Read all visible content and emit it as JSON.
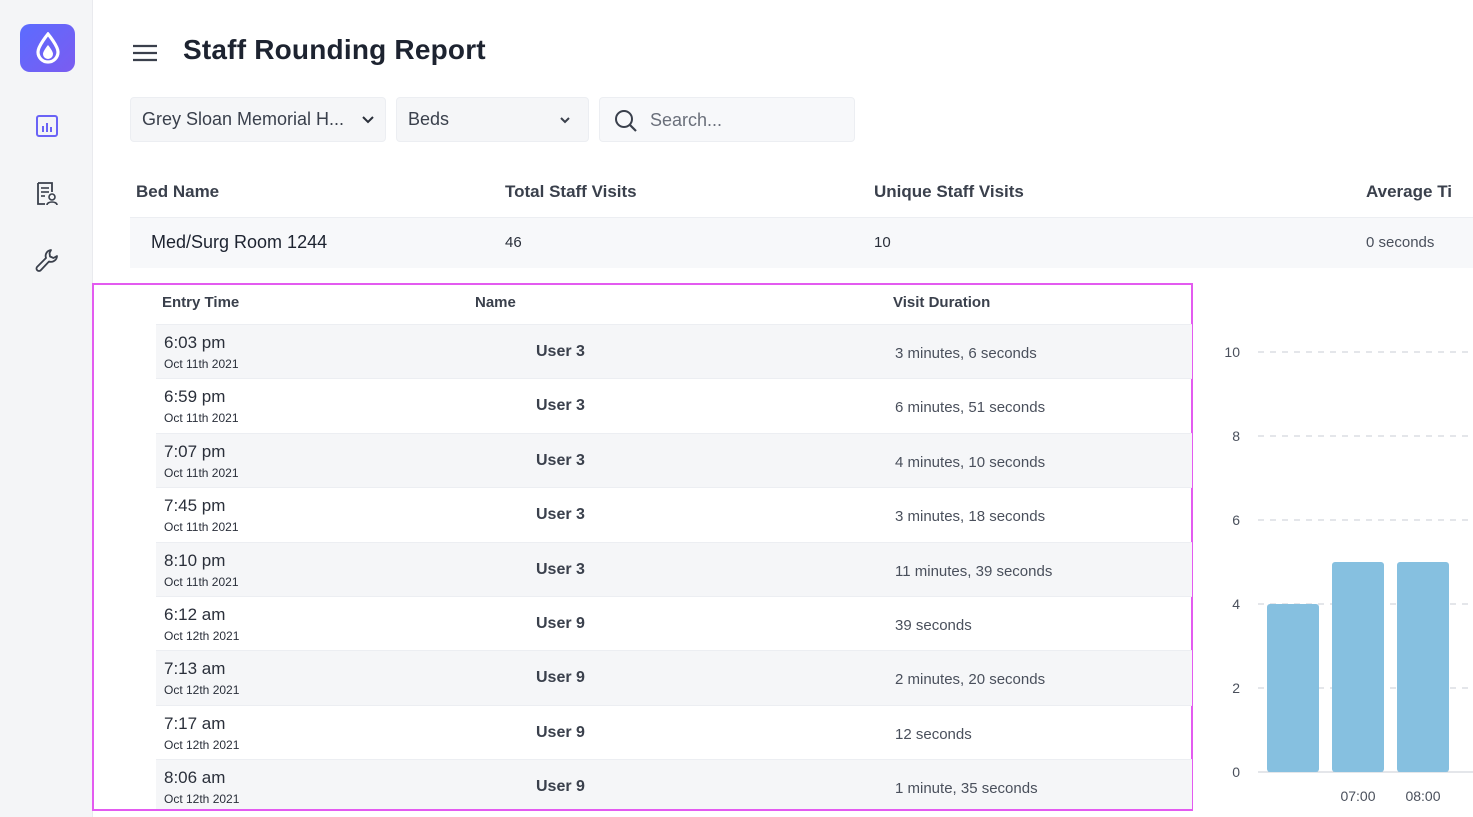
{
  "app": {
    "page_title": "Staff Rounding Report",
    "brand_color": "#6a63f6",
    "highlight_color": "#e35bf0",
    "bar_color": "#86c0e0"
  },
  "sidebar": {
    "items": [
      {
        "name": "reports-chart-icon"
      },
      {
        "name": "staff-report-icon"
      },
      {
        "name": "settings-wrench-icon"
      }
    ]
  },
  "filters": {
    "facility": "Grey Sloan Memorial H...",
    "type": "Beds",
    "search_placeholder": "Search..."
  },
  "bed_table": {
    "headers": [
      "Bed Name",
      "Total Staff Visits",
      "Unique Staff Visits",
      "Average Ti"
    ],
    "row": {
      "bed_name": "Med/Surg Room 1244",
      "total_visits": "46",
      "unique_visits": "10",
      "average_time": "0 seconds"
    }
  },
  "visits_table": {
    "headers": [
      "Entry Time",
      "Name",
      "Visit Duration"
    ],
    "rows": [
      {
        "time": "6:03 pm",
        "date": "Oct 11th 2021",
        "name": "User 3",
        "duration": "3 minutes, 6 seconds"
      },
      {
        "time": "6:59 pm",
        "date": "Oct 11th 2021",
        "name": "User 3",
        "duration": "6 minutes, 51 seconds"
      },
      {
        "time": "7:07 pm",
        "date": "Oct 11th 2021",
        "name": "User 3",
        "duration": "4 minutes, 10 seconds"
      },
      {
        "time": "7:45 pm",
        "date": "Oct 11th 2021",
        "name": "User 3",
        "duration": "3 minutes, 18 seconds"
      },
      {
        "time": "8:10 pm",
        "date": "Oct 11th 2021",
        "name": "User 3",
        "duration": "11 minutes, 39 seconds"
      },
      {
        "time": "6:12 am",
        "date": "Oct 12th 2021",
        "name": "User 9",
        "duration": "39 seconds"
      },
      {
        "time": "7:13 am",
        "date": "Oct 12th 2021",
        "name": "User 9",
        "duration": "2 minutes, 20 seconds"
      },
      {
        "time": "7:17 am",
        "date": "Oct 12th 2021",
        "name": "User 9",
        "duration": "12 seconds"
      },
      {
        "time": "8:06 am",
        "date": "Oct 12th 2021",
        "name": "User 9",
        "duration": "1 minute, 35 seconds"
      }
    ]
  },
  "chart_data": {
    "type": "bar",
    "categories": [
      "",
      "07:00",
      "08:00"
    ],
    "values": [
      4,
      5,
      5
    ],
    "y_ticks": [
      0,
      2,
      4,
      6,
      8,
      10
    ],
    "ylim": [
      0,
      10
    ],
    "grid": true
  }
}
